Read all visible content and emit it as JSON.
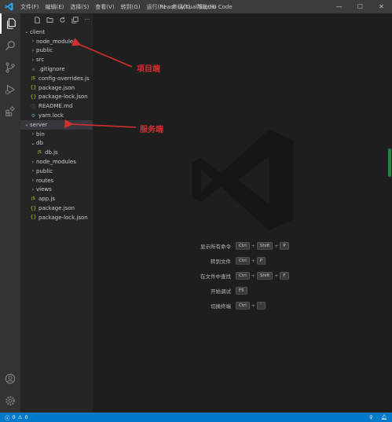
{
  "titlebar": {
    "menu": [
      "文件(F)",
      "编辑(E)",
      "选择(S)",
      "查看(V)",
      "转到(G)",
      "运行(R)",
      "终端(T)",
      "帮助(H)"
    ],
    "title": "React - Visual Studio Code",
    "controls": {
      "minimize": "—",
      "maximize": "☐",
      "close": "✕"
    }
  },
  "activity_bar": {
    "items": [
      "explorer-icon",
      "search-icon",
      "source-control-icon",
      "run-debug-icon",
      "extensions-icon"
    ],
    "bottom": [
      "account-icon",
      "settings-gear-icon"
    ]
  },
  "sidebar": {
    "toolbar": [
      "new-file-icon",
      "new-folder-icon",
      "refresh-icon",
      "collapse-all-icon",
      "more-icon"
    ],
    "more_label": "···",
    "tree": [
      {
        "label": "client",
        "kind": "folder-open",
        "depth": 0
      },
      {
        "label": "node_modules",
        "kind": "folder",
        "depth": 1
      },
      {
        "label": "public",
        "kind": "folder",
        "depth": 1
      },
      {
        "label": "src",
        "kind": "folder",
        "depth": 1
      },
      {
        "label": ".gitignore",
        "kind": "git",
        "depth": 1
      },
      {
        "label": "config-overrides.js",
        "kind": "js",
        "depth": 1
      },
      {
        "label": "package.json",
        "kind": "json",
        "depth": 1
      },
      {
        "label": "package-lock.json",
        "kind": "json",
        "depth": 1
      },
      {
        "label": "README.md",
        "kind": "md",
        "depth": 1
      },
      {
        "label": "yarn.lock",
        "kind": "yarn",
        "depth": 1
      },
      {
        "label": "server",
        "kind": "folder-open",
        "depth": 0
      },
      {
        "label": "bin",
        "kind": "folder",
        "depth": 1
      },
      {
        "label": "db",
        "kind": "folder-open",
        "depth": 1
      },
      {
        "label": "db.js",
        "kind": "js",
        "depth": 2
      },
      {
        "label": "node_modules",
        "kind": "folder",
        "depth": 1
      },
      {
        "label": "public",
        "kind": "folder",
        "depth": 1
      },
      {
        "label": "routes",
        "kind": "folder",
        "depth": 1
      },
      {
        "label": "views",
        "kind": "folder",
        "depth": 1
      },
      {
        "label": "app.js",
        "kind": "js",
        "depth": 1
      },
      {
        "label": "package.json",
        "kind": "json",
        "depth": 1
      },
      {
        "label": "package-lock.json",
        "kind": "json",
        "depth": 1
      }
    ]
  },
  "annotations": {
    "client": "项目端",
    "server": "服务端",
    "color": "#d32f2f"
  },
  "editor": {
    "shortcuts": [
      {
        "label": "显示所有命令",
        "keys": [
          "Ctrl",
          "Shift",
          "P"
        ]
      },
      {
        "label": "转到文件",
        "keys": [
          "Ctrl",
          "P"
        ]
      },
      {
        "label": "在文件中查找",
        "keys": [
          "Ctrl",
          "Shift",
          "F"
        ]
      },
      {
        "label": "开始调试",
        "keys": [
          "F5"
        ]
      },
      {
        "label": "切换终端",
        "keys": [
          "Ctrl",
          "`"
        ]
      }
    ],
    "plus": "+"
  },
  "statusbar": {
    "errors": "0",
    "warnings": "0",
    "right": [
      "live-share-icon",
      "bell-icon"
    ]
  },
  "colors": {
    "accent": "#007acc",
    "folder": "#c5c5c5",
    "js": "#cbcb41",
    "json": "#cbcb41",
    "md": "#519aba",
    "git": "#41535b",
    "yarn": "#519aba"
  }
}
